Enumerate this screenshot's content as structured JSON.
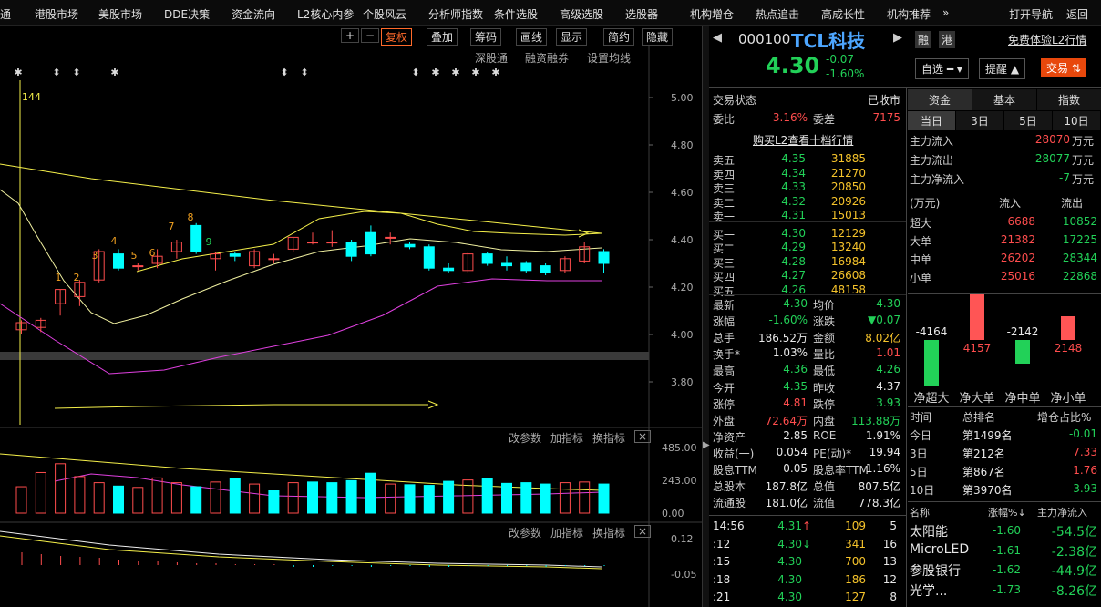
{
  "menu": [
    "通",
    "港股市场",
    "美股市场",
    "DDE决策",
    "资金流向",
    "L2核心内参",
    "个股风云",
    "分析师指数",
    "条件选股",
    "高级选股",
    "选股器",
    "机构增仓",
    "热点追击",
    "高成长性",
    "机构推荐",
    "»",
    "打开导航",
    "返回"
  ],
  "toolbar": {
    "plus": "+",
    "minus": "−",
    "fuquan": "复权",
    "overlay": "叠加",
    "chouma": "筹码",
    "huaxian": "画线",
    "display": "显示",
    "jianyue": "简约",
    "hide": "隐藏"
  },
  "sublinks": {
    "sgt": "深股通",
    "rzrq": "融资融券",
    "setma": "设置均线"
  },
  "axis": {
    "price": [
      "5.00",
      "4.80",
      "4.60",
      "4.40",
      "4.20",
      "4.00",
      "3.80"
    ],
    "vol": [
      "485.00",
      "243.00",
      "0.00"
    ],
    "macd": [
      "0.12",
      "-0.05"
    ]
  },
  "indic": {
    "change": "改参数",
    "add": "加指标",
    "switch": "换指标",
    "close": "×"
  },
  "annot": {
    "count": "144",
    "seq": [
      "1",
      "2",
      "3",
      "4",
      "5",
      "6",
      "7",
      "8",
      "9"
    ]
  },
  "stock": {
    "code": "000100",
    "name": "TCL科技",
    "rong": "融",
    "gang": "港",
    "l2free": "免费体验L2行情",
    "price": "4.30",
    "chg": "-0.07",
    "pct": "-1.60%",
    "zixuan": "自选",
    "remind": "提醒",
    "trade": "交易"
  },
  "status": {
    "label": "交易状态",
    "value": "已收市",
    "wb_label": "委比",
    "wb": "3.16%",
    "wc_label": "委差",
    "wc": "7175",
    "buyL2": "购买L2查看十档行情"
  },
  "orderbook": [
    {
      "n": "卖五",
      "p": "4.35",
      "v": "31885",
      "c": "g"
    },
    {
      "n": "卖四",
      "p": "4.34",
      "v": "21270",
      "c": "g"
    },
    {
      "n": "卖三",
      "p": "4.33",
      "v": "20850",
      "c": "g"
    },
    {
      "n": "卖二",
      "p": "4.32",
      "v": "20926",
      "c": "g"
    },
    {
      "n": "卖一",
      "p": "4.31",
      "v": "15013",
      "c": "g"
    },
    {
      "n": "买一",
      "p": "4.30",
      "v": "12129",
      "c": "g"
    },
    {
      "n": "买二",
      "p": "4.29",
      "v": "13240",
      "c": "g"
    },
    {
      "n": "买三",
      "p": "4.28",
      "v": "16984",
      "c": "g"
    },
    {
      "n": "买四",
      "p": "4.27",
      "v": "26608",
      "c": "g"
    },
    {
      "n": "买五",
      "p": "4.26",
      "v": "48158",
      "c": "g"
    }
  ],
  "stats": [
    [
      "最新",
      "4.30",
      "g",
      "均价",
      "4.30",
      "g"
    ],
    [
      "涨幅",
      "-1.60%",
      "g",
      "涨跌",
      "▼0.07",
      "g"
    ],
    [
      "总手",
      "186.52万",
      "w",
      "金额",
      "8.02亿",
      "y"
    ],
    [
      "换手*",
      "1.03%",
      "w",
      "量比",
      "1.01",
      "r"
    ],
    [
      "最高",
      "4.36",
      "g",
      "最低",
      "4.26",
      "g"
    ],
    [
      "今开",
      "4.35",
      "g",
      "昨收",
      "4.37",
      "w"
    ],
    [
      "涨停",
      "4.81",
      "r",
      "跌停",
      "3.93",
      "g"
    ],
    [
      "外盘",
      "72.64万",
      "r",
      "内盘",
      "113.88万",
      "g"
    ],
    [
      "净资产",
      "2.85",
      "w",
      "ROE",
      "1.91%",
      "w"
    ],
    [
      "收益(一)",
      "0.054",
      "w",
      "PE(动)*",
      "19.94",
      "w"
    ],
    [
      "股息TTM",
      "0.05",
      "w",
      "股息率TTM",
      "1.16%",
      "w"
    ],
    [
      "总股本",
      "187.8亿",
      "w",
      "总值",
      "807.5亿",
      "w"
    ],
    [
      "流通股",
      "181.0亿",
      "w",
      "流值",
      "778.3亿",
      "w"
    ]
  ],
  "ticks": [
    [
      "14:56",
      "4.31",
      "↑",
      "109",
      "5"
    ],
    [
      ":12",
      "4.30",
      "↓",
      "341",
      "16"
    ],
    [
      ":15",
      "4.30",
      "",
      "700",
      "13"
    ],
    [
      ":18",
      "4.30",
      "",
      "186",
      "12"
    ],
    [
      ":21",
      "4.30",
      "",
      "127",
      "8"
    ]
  ],
  "tabs": {
    "main": [
      "资金",
      "基本",
      "指数"
    ],
    "days": [
      "当日",
      "3日",
      "5日",
      "10日"
    ]
  },
  "flow": {
    "in_l": "主力流入",
    "in": "28070",
    "out_l": "主力流出",
    "out": "28077",
    "net_l": "主力净流入",
    "net": "-7",
    "unit": "万元",
    "unit_hdr": "(万元)",
    "in_hdr": "流入",
    "out_hdr": "流出"
  },
  "flowtable": [
    [
      "超大",
      "6688",
      "10852"
    ],
    [
      "大单",
      "21382",
      "17225"
    ],
    [
      "中单",
      "26202",
      "28344"
    ],
    [
      "小单",
      "25016",
      "22868"
    ]
  ],
  "netbars": [
    {
      "l": "净超大",
      "v": -4164
    },
    {
      "l": "净大单",
      "v": 4157
    },
    {
      "l": "净中单",
      "v": -2142
    },
    {
      "l": "净小单",
      "v": 2148
    }
  ],
  "rank": {
    "h1": "时间",
    "h2": "总排名",
    "h3": "增仓占比%",
    "rows": [
      [
        "今日",
        "第1499名",
        "-0.01",
        "g"
      ],
      [
        "3日",
        "第212名",
        "7.33",
        "r"
      ],
      [
        "5日",
        "第867名",
        "1.76",
        "r"
      ],
      [
        "10日",
        "第3970名",
        "-3.93",
        "g"
      ]
    ]
  },
  "concept": {
    "h1": "名称",
    "h2": "涨幅%↓",
    "h3": "主力净流入",
    "rows": [
      [
        "太阳能",
        "-1.60",
        "-54.5亿"
      ],
      [
        "MicroLED",
        "-1.61",
        "-2.38亿"
      ],
      [
        "参股银行",
        "-1.62",
        "-44.9亿"
      ],
      [
        "光学...",
        "-1.73",
        "-8.26亿"
      ]
    ]
  },
  "colors": {
    "up": "#ff4d4d",
    "down": "#22d158",
    "cyan": "#00ffff",
    "ma": "#f5f04a",
    "magenta": "#e040e0",
    "accent": "#e8480c"
  },
  "chart_data": {
    "type": "candlestick",
    "ylim": [
      3.7,
      5.05
    ],
    "candles": [
      [
        4.02,
        4.05,
        4.0,
        4.06
      ],
      [
        4.03,
        4.06,
        4.01,
        4.07
      ],
      [
        4.13,
        4.19,
        4.08,
        4.19
      ],
      [
        4.16,
        4.22,
        4.12,
        4.23
      ],
      [
        4.23,
        4.35,
        4.22,
        4.36
      ],
      [
        4.34,
        4.28,
        4.27,
        4.36
      ],
      [
        4.29,
        4.29,
        4.27,
        4.3
      ],
      [
        4.3,
        4.33,
        4.28,
        4.36
      ],
      [
        4.35,
        4.39,
        4.32,
        4.4
      ],
      [
        4.46,
        4.35,
        4.34,
        4.47
      ],
      [
        4.32,
        4.34,
        4.27,
        4.35
      ],
      [
        4.34,
        4.33,
        4.31,
        4.35
      ],
      [
        4.29,
        4.35,
        4.28,
        4.36
      ],
      [
        4.32,
        4.32,
        4.3,
        4.34
      ],
      [
        4.36,
        4.41,
        4.35,
        4.41
      ],
      [
        4.39,
        4.39,
        4.38,
        4.43
      ],
      [
        4.39,
        4.39,
        4.37,
        4.44
      ],
      [
        4.39,
        4.33,
        4.31,
        4.4
      ],
      [
        4.43,
        4.34,
        4.33,
        4.46
      ],
      [
        4.41,
        4.41,
        4.38,
        4.43
      ],
      [
        4.38,
        4.37,
        4.36,
        4.39
      ],
      [
        4.37,
        4.28,
        4.27,
        4.38
      ],
      [
        4.28,
        4.27,
        4.26,
        4.3
      ],
      [
        4.27,
        4.34,
        4.26,
        4.35
      ],
      [
        4.34,
        4.3,
        4.29,
        4.35
      ],
      [
        4.3,
        4.29,
        4.27,
        4.33
      ],
      [
        4.3,
        4.27,
        4.26,
        4.31
      ],
      [
        4.29,
        4.26,
        4.25,
        4.3
      ],
      [
        4.27,
        4.32,
        4.26,
        4.33
      ],
      [
        4.31,
        4.37,
        4.3,
        4.39
      ],
      [
        4.35,
        4.3,
        4.26,
        4.36
      ]
    ],
    "vol": [
      195,
      300,
      365,
      270,
      225,
      200,
      190,
      260,
      225,
      195,
      230,
      255,
      215,
      165,
      225,
      230,
      225,
      240,
      295,
      215,
      210,
      205,
      235,
      245,
      255,
      220,
      225,
      215,
      225,
      230,
      215
    ],
    "vol_up": [
      1,
      1,
      1,
      1,
      1,
      0,
      1,
      1,
      1,
      0,
      1,
      0,
      1,
      0,
      1,
      0,
      0,
      0,
      0,
      1,
      0,
      0,
      0,
      1,
      0,
      0,
      0,
      0,
      1,
      1,
      0
    ]
  }
}
